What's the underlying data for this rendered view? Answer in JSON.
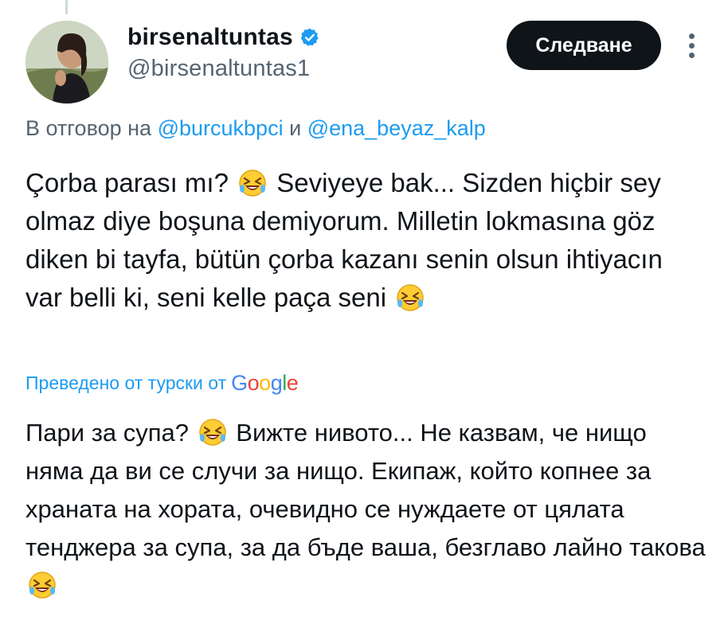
{
  "author": {
    "display_name": "birsenaltuntas",
    "handle": "@birsenaltuntas1",
    "verified": true
  },
  "actions": {
    "follow_label": "Следване",
    "more_icon": "more-vertical-icon"
  },
  "reply": {
    "prefix": "В отговор на",
    "mention1": "@burcukbpci",
    "conj": "и",
    "mention2": "@ena_beyaz_kalp"
  },
  "tweet": {
    "seg1": "Çorba parası mı?",
    "seg2": "Seviyeye bak... Sizden hiçbir sey olmaz diye boşuna demiyorum. Milletin lokmasına göz diken bi tayfa, bütün çorba kazanı senin olsun ihtiyacın var belli ki, seni kelle paça seni"
  },
  "translation": {
    "label": "Преведено от турски от",
    "provider": "Google",
    "seg1": "Пари за супа?",
    "seg2": "Вижте нивото... Не казвам, че нищо няма да ви се случи за нищо. Екипаж, който копнее за храната на хората, очевидно се нуждаете от цялата тенджера за супа, за да бъде ваша, безглаво лайно такова"
  },
  "colors": {
    "accent": "#1d9bf0",
    "text": "#0f1419",
    "secondary": "#536471",
    "button_bg": "#0f1419"
  },
  "icons": {
    "verified": "verified-badge-icon",
    "emoji": "rolling-on-floor-laughing-emoji"
  }
}
